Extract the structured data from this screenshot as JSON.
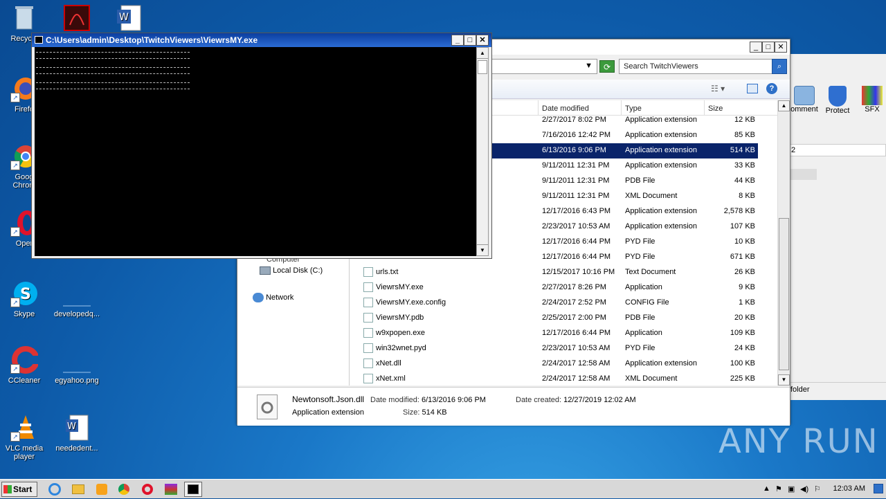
{
  "desktop": {
    "icons": [
      {
        "label": "Recycle"
      },
      {
        "label": "Firefo"
      },
      {
        "label": "Goog Chrom"
      },
      {
        "label": "Oper"
      },
      {
        "label": "Skype"
      },
      {
        "label": "developedq..."
      },
      {
        "label": "CCleaner"
      },
      {
        "label": "egyahoo.png"
      },
      {
        "label": "VLC media player"
      },
      {
        "label": "neededent..."
      }
    ]
  },
  "console": {
    "title": "C:\\Users\\admin\\Desktop\\TwitchViewers\\ViewrsMY.exe",
    "min": "_",
    "max": "□",
    "close": "✕"
  },
  "explorer": {
    "search_placeholder": "Search TwitchViewers",
    "columns": {
      "date": "Date modified",
      "type": "Type",
      "size": "Size"
    },
    "nav": {
      "computer": "Computer",
      "local_disk": "Local Disk (C:)",
      "network": "Network"
    },
    "rows": [
      {
        "name": "",
        "date": "2/27/2017 8:02 PM",
        "type": "Application extension",
        "size": "12 KB"
      },
      {
        "name": "",
        "date": "7/16/2016 12:42 PM",
        "type": "Application extension",
        "size": "85 KB"
      },
      {
        "name": "",
        "date": "6/13/2016 9:06 PM",
        "type": "Application extension",
        "size": "514 KB",
        "selected": true
      },
      {
        "name": "",
        "date": "9/11/2011 12:31 PM",
        "type": "Application extension",
        "size": "33 KB"
      },
      {
        "name": "",
        "date": "9/11/2011 12:31 PM",
        "type": "PDB File",
        "size": "44 KB"
      },
      {
        "name": "",
        "date": "9/11/2011 12:31 PM",
        "type": "XML Document",
        "size": "8 KB"
      },
      {
        "name": "",
        "date": "12/17/2016 6:43 PM",
        "type": "Application extension",
        "size": "2,578 KB"
      },
      {
        "name": "",
        "date": "2/23/2017 10:53 AM",
        "type": "Application extension",
        "size": "107 KB"
      },
      {
        "name": "",
        "date": "12/17/2016 6:44 PM",
        "type": "PYD File",
        "size": "10 KB"
      },
      {
        "name": "",
        "date": "12/17/2016 6:44 PM",
        "type": "PYD File",
        "size": "671 KB"
      },
      {
        "name": "urls.txt",
        "date": "12/15/2017 10:16 PM",
        "type": "Text Document",
        "size": "26 KB"
      },
      {
        "name": "ViewrsMY.exe",
        "date": "2/27/2017 8:26 PM",
        "type": "Application",
        "size": "9 KB"
      },
      {
        "name": "ViewrsMY.exe.config",
        "date": "2/24/2017 2:52 PM",
        "type": "CONFIG File",
        "size": "1 KB"
      },
      {
        "name": "ViewrsMY.pdb",
        "date": "2/25/2017 2:00 PM",
        "type": "PDB File",
        "size": "20 KB"
      },
      {
        "name": "w9xpopen.exe",
        "date": "12/17/2016 6:44 PM",
        "type": "Application",
        "size": "109 KB"
      },
      {
        "name": "win32wnet.pyd",
        "date": "2/23/2017 10:53 AM",
        "type": "PYD File",
        "size": "24 KB"
      },
      {
        "name": "xNet.dll",
        "date": "2/24/2017 12:58 AM",
        "type": "Application extension",
        "size": "100 KB"
      },
      {
        "name": "xNet.xml",
        "date": "2/24/2017 12:58 AM",
        "type": "XML Document",
        "size": "225 KB"
      }
    ],
    "details": {
      "filename": "Newtonsoft.Json.dll",
      "date_modified_label": "Date modified:",
      "date_modified": "6/13/2016 9:06 PM",
      "date_created_label": "Date created:",
      "date_created": "12/27/2019 12:02 AM",
      "type": "Application extension",
      "size_label": "Size:",
      "size": "514 KB"
    }
  },
  "rightwin": {
    "comment": "omment",
    "protect": "Protect",
    "sfx": "SFX",
    "folder": "folder",
    "col2": "2"
  },
  "taskbar": {
    "start": "Start",
    "clock": "12:03 AM"
  },
  "watermark": "ANY RUN"
}
